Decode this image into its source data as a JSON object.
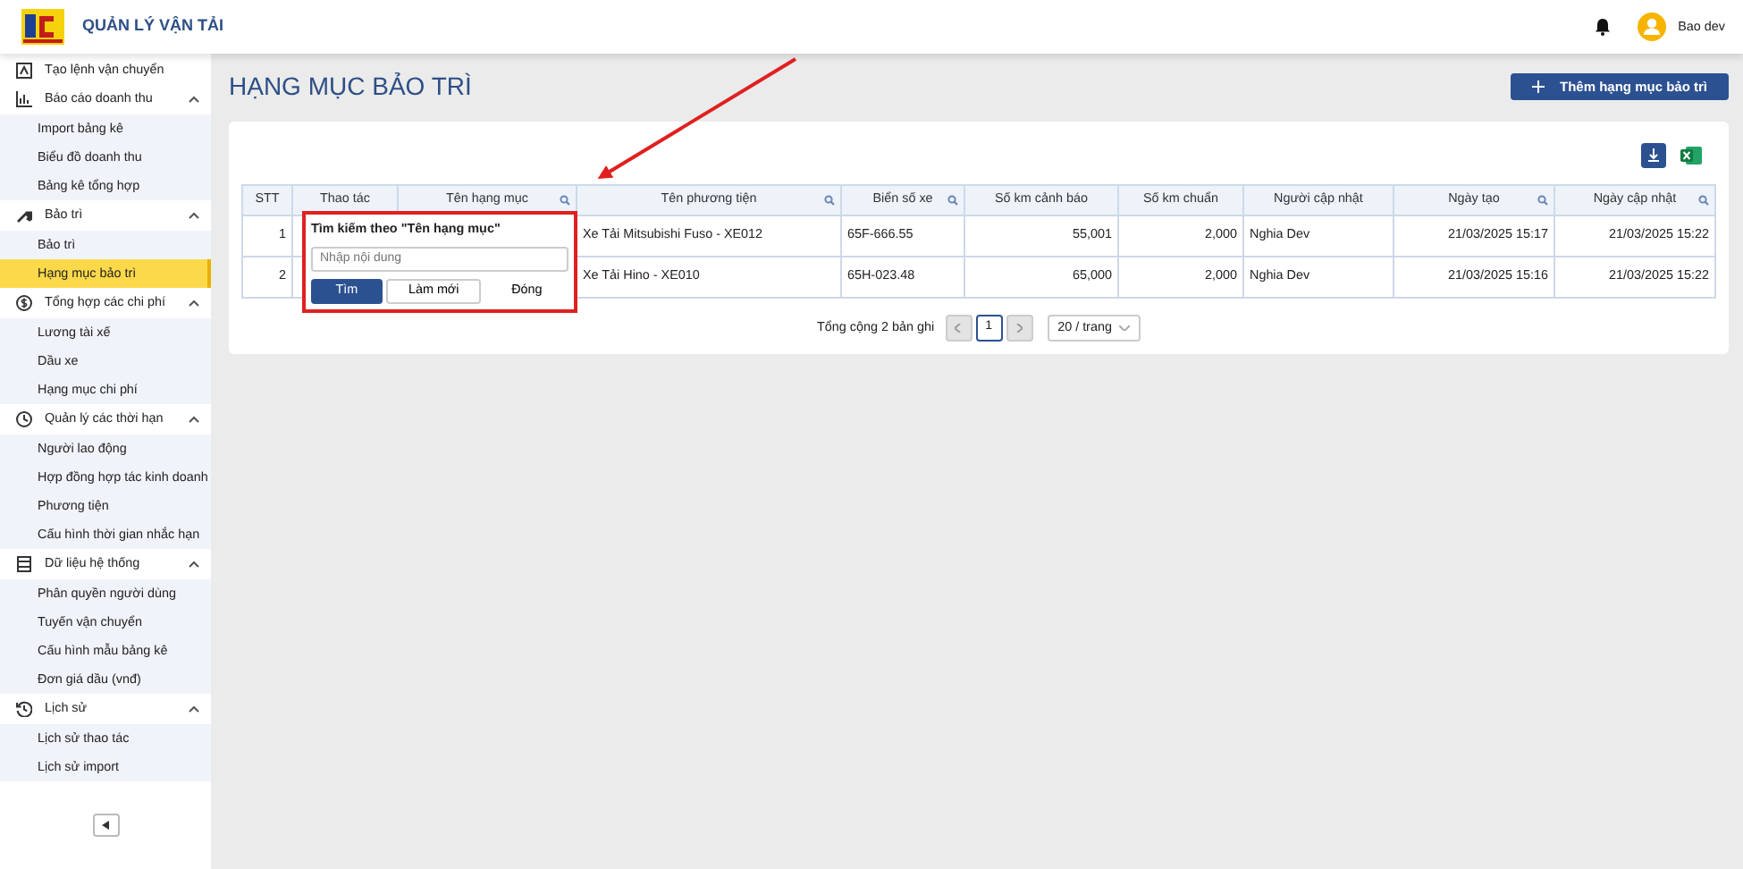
{
  "header": {
    "app_title": "QUẢN LÝ VẬN TẢI",
    "user_name": "Bao dev"
  },
  "sidebar": {
    "items": [
      {
        "kind": "link",
        "label": "Tạo lệnh vận chuyển"
      },
      {
        "kind": "group",
        "label": "Báo cáo doanh thu",
        "expanded": true,
        "children": [
          {
            "label": "Import bảng kê",
            "selected": false
          },
          {
            "label": "Biểu đồ doanh thu",
            "selected": false
          },
          {
            "label": "Bảng kê tổng hợp",
            "selected": false
          }
        ]
      },
      {
        "kind": "group",
        "label": "Bảo trì",
        "expanded": true,
        "children": [
          {
            "label": "Bảo trì",
            "selected": false
          },
          {
            "label": "Hạng mục bảo trì",
            "selected": true
          }
        ]
      },
      {
        "kind": "group",
        "label": "Tổng hợp các chi phí",
        "expanded": true,
        "children": [
          {
            "label": "Lương tài xế",
            "selected": false
          },
          {
            "label": "Dầu xe",
            "selected": false
          },
          {
            "label": "Hạng mục chi phí",
            "selected": false
          }
        ]
      },
      {
        "kind": "group",
        "label": "Quản lý các thời hạn",
        "expanded": true,
        "children": [
          {
            "label": "Người lao động",
            "selected": false
          },
          {
            "label": "Hợp đồng hợp tác kinh doanh",
            "selected": false
          },
          {
            "label": "Phương tiện",
            "selected": false
          },
          {
            "label": "Cấu hình thời gian nhắc hạn",
            "selected": false
          }
        ]
      },
      {
        "kind": "group",
        "label": "Dữ liệu hệ thống",
        "expanded": true,
        "children": [
          {
            "label": "Phân quyền người dùng",
            "selected": false
          },
          {
            "label": "Tuyến vận chuyển",
            "selected": false
          },
          {
            "label": "Cấu hình mẫu bảng kê",
            "selected": false
          },
          {
            "label": "Đơn giá dầu (vnđ)",
            "selected": false
          }
        ]
      },
      {
        "kind": "group",
        "label": "Lịch sử",
        "expanded": true,
        "children": [
          {
            "label": "Lịch sử thao tác",
            "selected": false
          },
          {
            "label": "Lịch sử import",
            "selected": false
          }
        ]
      }
    ]
  },
  "page": {
    "title": "HẠNG MỤC BẢO TRÌ",
    "add_button": "Thêm hạng mục bảo trì"
  },
  "table": {
    "columns": [
      {
        "label": "STT",
        "searchable": false
      },
      {
        "label": "Thao tác",
        "searchable": false
      },
      {
        "label": "Tên hạng mục",
        "searchable": true
      },
      {
        "label": "Tên phương tiện",
        "searchable": true
      },
      {
        "label": "Biển số xe",
        "searchable": true
      },
      {
        "label": "Số km cảnh báo",
        "searchable": false
      },
      {
        "label": "Số km chuẩn",
        "searchable": false
      },
      {
        "label": "Người cập nhật",
        "searchable": false
      },
      {
        "label": "Ngày tạo",
        "searchable": true
      },
      {
        "label": "Ngày cập nhật",
        "searchable": true
      }
    ],
    "rows": [
      {
        "stt": "1",
        "vehicle": "Xe Tải Mitsubishi Fuso - XE012",
        "plate": "65F-666.55",
        "warn_km": "55,001",
        "std_km": "2,000",
        "updated_by": "Nghia Dev",
        "created": "21/03/2025 15:17",
        "updated": "21/03/2025 15:22"
      },
      {
        "stt": "2",
        "vehicle": "Xe Tải Hino - XE010",
        "plate": "65H-023.48",
        "warn_km": "65,000",
        "std_km": "2,000",
        "updated_by": "Nghia Dev",
        "created": "21/03/2025 15:16",
        "updated": "21/03/2025 15:22"
      }
    ]
  },
  "filter_popup": {
    "title": "Tìm kiếm theo \"Tên hạng mục\"",
    "placeholder": "Nhập nội dung",
    "buttons": [
      {
        "label": "Tìm",
        "kind": "primary"
      },
      {
        "label": "Làm mới",
        "kind": "outline"
      },
      {
        "label": "Đóng",
        "kind": "text"
      }
    ]
  },
  "pagination": {
    "total": "Tổng cộng 2 bản ghi",
    "pages": [
      {
        "label": "1",
        "selected": true
      }
    ],
    "page_size": "20 / trang"
  }
}
